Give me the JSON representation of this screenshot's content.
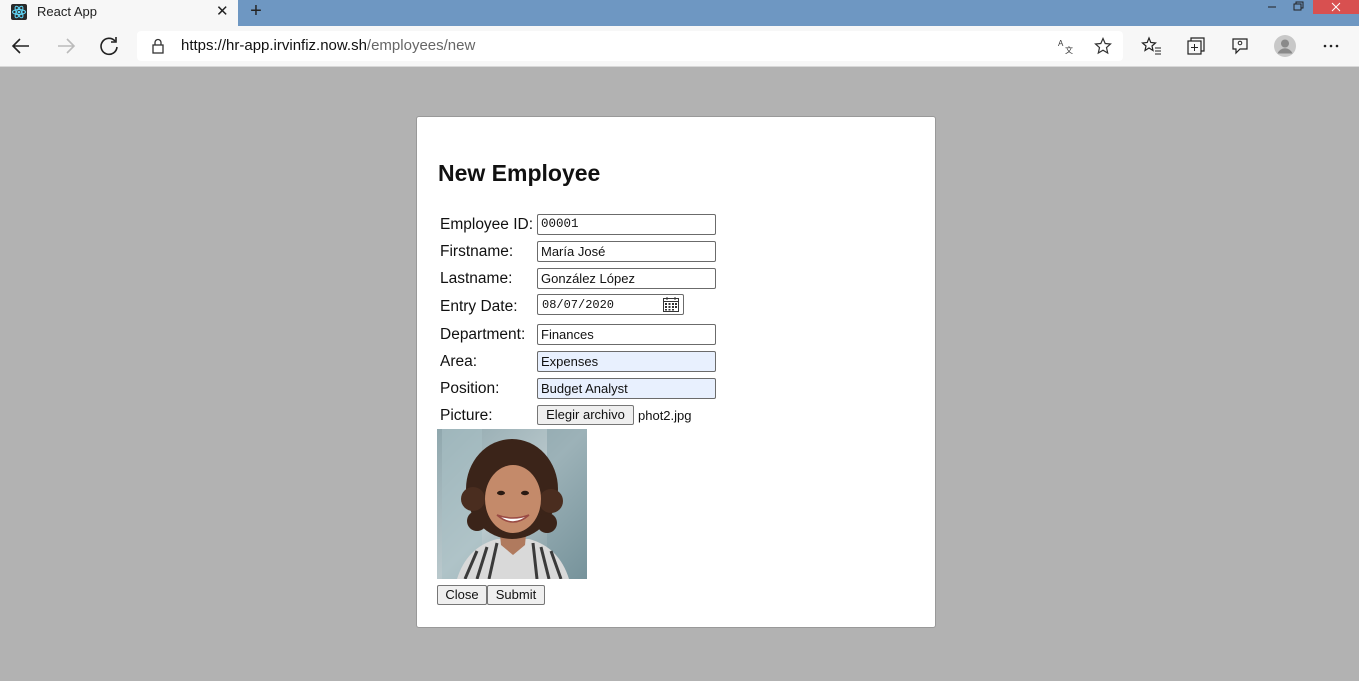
{
  "browser": {
    "tab_title": "React App",
    "tab_close": "✕",
    "new_tab": "+",
    "url_host": "https://hr-app.irvinfiz.now.sh",
    "url_path": "/employees/new"
  },
  "form": {
    "title": "New Employee",
    "labels": {
      "employee_id": "Employee ID:",
      "firstname": "Firstname:",
      "lastname": "Lastname:",
      "entry_date": "Entry Date:",
      "department": "Department:",
      "area": "Area:",
      "position": "Position:",
      "picture": "Picture:"
    },
    "values": {
      "employee_id": "00001",
      "firstname": "María José",
      "lastname": "González López",
      "entry_date": "08/07/2020",
      "department": "Finances",
      "area": "Expenses",
      "position": "Budget Analyst",
      "picture_file": "phot2.jpg"
    },
    "file_button": "Elegir archivo",
    "close_button": "Close",
    "submit_button": "Submit"
  },
  "icons": [
    "react-icon",
    "back-icon",
    "forward-icon",
    "refresh-icon",
    "lock-icon",
    "translate-icon",
    "star-icon",
    "favorites-icon",
    "collections-icon",
    "feedback-icon",
    "profile-icon",
    "more-icon",
    "calendar-icon"
  ],
  "colors": {
    "titlebar": "#6e97c2",
    "overlay": "#b2b2b2",
    "autofill": "#e8f0fe",
    "close": "#d85050"
  }
}
